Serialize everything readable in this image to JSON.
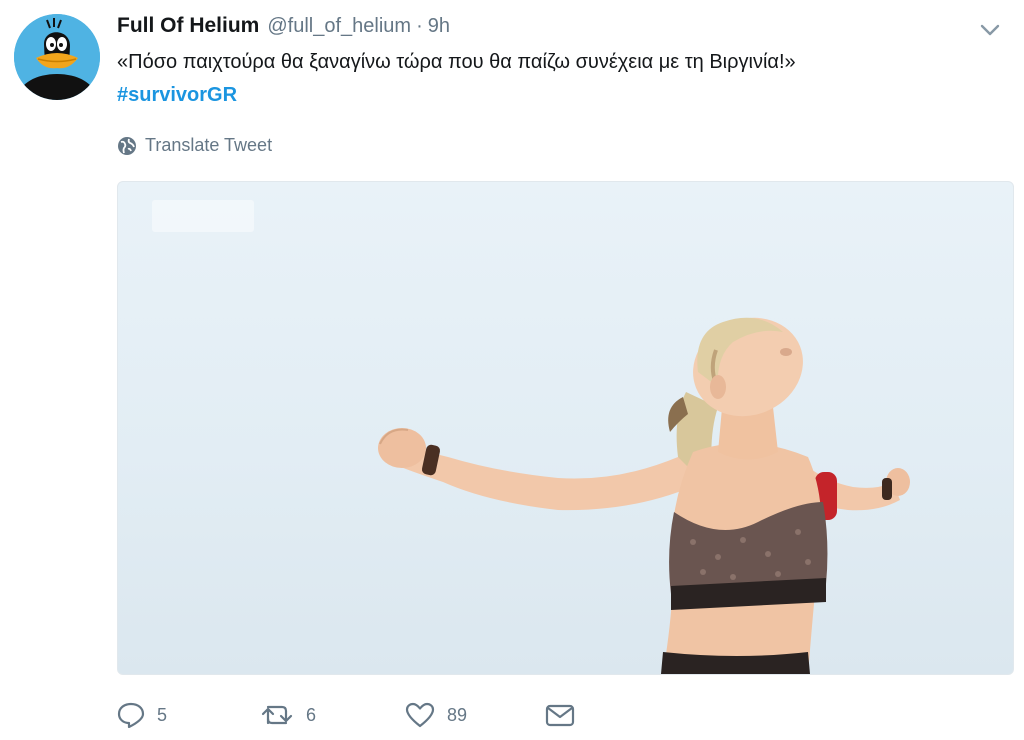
{
  "tweet": {
    "display_name": "Full Of Helium",
    "handle": "@full_of_helium",
    "separator": "·",
    "time": "9h",
    "text": "«Πόσο παιχτούρα θα ξαναγίνω τώρα που θα παίζω συνέχεια με τη Βιργινία!»",
    "hashtag": "#survivorGR",
    "translate_label": "Translate Tweet"
  },
  "actions": {
    "reply_count": "5",
    "retweet_count": "6",
    "like_count": "89"
  },
  "icons": {
    "caret": "chevron-down-icon",
    "globe": "globe-icon",
    "reply": "reply-icon",
    "retweet": "retweet-icon",
    "like": "heart-icon",
    "dm": "envelope-icon"
  },
  "colors": {
    "link": "#1b95e0",
    "muted": "#657786",
    "text": "#14171a",
    "avatar_bg": "#4fb3e3"
  }
}
